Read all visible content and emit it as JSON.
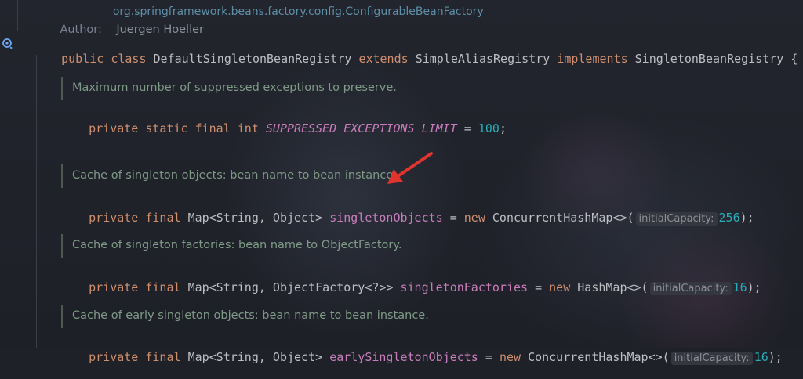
{
  "header": {
    "package_fragment": "org.springframework.beans.factory.config.ConfigurableBeanFactory",
    "author_label": "Author:",
    "author_name": "Juergen Hoeller"
  },
  "class_decl": {
    "kw_public": "public",
    "kw_class": "class",
    "class_name": "DefaultSingletonBeanRegistry",
    "kw_extends": "extends",
    "super_name": "SimpleAliasRegistry",
    "kw_implements": "implements",
    "iface_name": "SingletonBeanRegistry",
    "brace": "{"
  },
  "fields": [
    {
      "doc": "Maximum number of suppressed exceptions to preserve.",
      "modifiers": "private static final int",
      "name": "SUPPRESSED_EXCEPTIONS_LIMIT",
      "eq": "=",
      "value": "100",
      "end": ";"
    },
    {
      "doc": "Cache of singleton objects: bean name to bean instance.",
      "modifiers": "private final",
      "type": "Map<String, Object>",
      "name": "singletonObjects",
      "eq": "=",
      "kw_new": "new",
      "ctor": "ConcurrentHashMap<>(",
      "hint": "initialCapacity:",
      "value": "256",
      "end": ");"
    },
    {
      "doc": "Cache of singleton factories: bean name to ObjectFactory.",
      "modifiers": "private final",
      "type": "Map<String, ObjectFactory<?>>",
      "name": "singletonFactories",
      "eq": "=",
      "kw_new": "new",
      "ctor": "HashMap<>(",
      "hint": "initialCapacity:",
      "value": "16",
      "end": ");"
    },
    {
      "doc": "Cache of early singleton objects: bean name to bean instance.",
      "modifiers": "private final",
      "type": "Map<String, Object>",
      "name": "earlySingletonObjects",
      "eq": "=",
      "kw_new": "new",
      "ctor": "ConcurrentHashMap<>(",
      "hint": "initialCapacity:",
      "value": "16",
      "end": ");"
    }
  ],
  "icons": {
    "gutter": "implemented-interface-icon",
    "arrow": "annotation-arrow-icon"
  },
  "colors": {
    "keyword": "#cf8e6d",
    "field": "#c77dbb",
    "number": "#2aacb8",
    "doc_comment": "#7f9a86",
    "arrow": "#e0342f"
  }
}
